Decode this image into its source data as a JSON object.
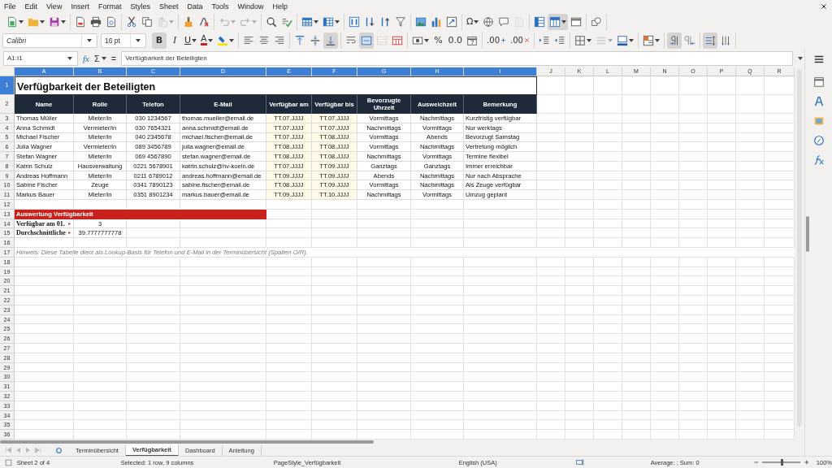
{
  "menu": [
    "File",
    "Edit",
    "View",
    "Insert",
    "Format",
    "Styles",
    "Sheet",
    "Data",
    "Tools",
    "Window",
    "Help"
  ],
  "toolbar_1": [
    [
      {
        "kind": "newsheet",
        "dropdown": true,
        "pressed": false,
        "disabled": false
      },
      {
        "kind": "folder",
        "dropdown": true,
        "pressed": false,
        "disabled": false
      },
      {
        "kind": "floppy",
        "dropdown": true,
        "pressed": false,
        "disabled": false
      }
    ],
    [
      {
        "kind": "pdf",
        "dropdown": false,
        "pressed": false,
        "disabled": false
      },
      {
        "kind": "printer",
        "dropdown": false,
        "pressed": false,
        "disabled": false
      },
      {
        "kind": "preview",
        "dropdown": false,
        "pressed": false,
        "disabled": false
      }
    ],
    [
      {
        "kind": "scissors",
        "dropdown": false,
        "pressed": false,
        "disabled": false
      },
      {
        "kind": "copy",
        "dropdown": false,
        "pressed": false,
        "disabled": false
      },
      {
        "kind": "paste",
        "dropdown": true,
        "pressed": false,
        "disabled": true
      }
    ],
    [
      {
        "kind": "brush",
        "dropdown": false,
        "pressed": false,
        "disabled": false
      },
      {
        "kind": "eraser",
        "dropdown": false,
        "pressed": false,
        "disabled": false
      }
    ],
    [
      {
        "kind": "undo",
        "dropdown": true,
        "pressed": false,
        "disabled": true
      },
      {
        "kind": "redo",
        "dropdown": true,
        "pressed": false,
        "disabled": true
      }
    ],
    [
      {
        "kind": "find",
        "dropdown": false,
        "pressed": false,
        "disabled": false
      },
      {
        "kind": "spell",
        "dropdown": false,
        "pressed": false,
        "disabled": false
      }
    ],
    [
      {
        "kind": "rows",
        "dropdown": true,
        "pressed": false,
        "disabled": false
      },
      {
        "kind": "cols",
        "dropdown": true,
        "pressed": false,
        "disabled": false
      }
    ],
    [
      {
        "kind": "sortaz",
        "dropdown": false,
        "pressed": false,
        "disabled": false
      },
      {
        "kind": "sortup",
        "dropdown": false,
        "pressed": false,
        "disabled": false
      },
      {
        "kind": "sortdown",
        "dropdown": false,
        "pressed": false,
        "disabled": false
      },
      {
        "kind": "funnel",
        "dropdown": false,
        "pressed": false,
        "disabled": false
      }
    ],
    [
      {
        "kind": "image",
        "dropdown": false,
        "pressed": false,
        "disabled": false
      },
      {
        "kind": "chart",
        "dropdown": false,
        "pressed": false,
        "disabled": false
      },
      {
        "kind": "pivot",
        "dropdown": false,
        "pressed": false,
        "disabled": false
      }
    ],
    [
      {
        "kind": "text",
        "label": "Ω",
        "dropdown": true,
        "pressed": false,
        "disabled": false
      },
      {
        "kind": "globe",
        "dropdown": false,
        "pressed": false,
        "disabled": false
      },
      {
        "kind": "comment",
        "dropdown": false,
        "pressed": false,
        "disabled": false
      },
      {
        "kind": "page",
        "dropdown": false,
        "pressed": false,
        "disabled": true
      }
    ],
    [
      {
        "kind": "freeze",
        "dropdown": false,
        "pressed": false,
        "disabled": false
      },
      {
        "kind": "freezerows",
        "dropdown": true,
        "pressed": true,
        "disabled": false
      },
      {
        "kind": "split",
        "dropdown": false,
        "pressed": false,
        "disabled": false
      }
    ],
    [
      {
        "kind": "shapes",
        "dropdown": false,
        "pressed": false,
        "disabled": false
      }
    ]
  ],
  "toolbar_2": {
    "font_name": "Calibri",
    "font_size": "16 pt",
    "groups": [
      [
        {
          "kind": "bold",
          "label": "B",
          "dropdown": false,
          "pressed": true,
          "disabled": false
        },
        {
          "kind": "italic",
          "label": "I",
          "dropdown": false,
          "pressed": false,
          "disabled": false
        },
        {
          "kind": "underline",
          "label": "U",
          "dropdown": true,
          "pressed": false,
          "disabled": false
        },
        {
          "kind": "fontcolor",
          "label": "A",
          "dropdown": true,
          "pressed": false,
          "disabled": false
        },
        {
          "kind": "highlight",
          "dropdown": true,
          "pressed": false,
          "disabled": false
        }
      ],
      [
        {
          "kind": "alignleft",
          "dropdown": false,
          "pressed": false,
          "disabled": false
        },
        {
          "kind": "aligncenter",
          "dropdown": false,
          "pressed": false,
          "disabled": false
        },
        {
          "kind": "alignright",
          "dropdown": false,
          "pressed": false,
          "disabled": false
        }
      ],
      [
        {
          "kind": "aligntop",
          "dropdown": false,
          "pressed": false,
          "disabled": false
        },
        {
          "kind": "alignmiddle",
          "dropdown": false,
          "pressed": false,
          "disabled": false
        },
        {
          "kind": "alignbottom",
          "dropdown": false,
          "pressed": true,
          "disabled": false
        }
      ],
      [
        {
          "kind": "wrap",
          "dropdown": false,
          "pressed": false,
          "disabled": false
        },
        {
          "kind": "mergecenter",
          "dropdown": false,
          "pressed": true,
          "disabled": false
        },
        {
          "kind": "merge",
          "dropdown": false,
          "pressed": false,
          "disabled": true
        },
        {
          "kind": "unmerge",
          "dropdown": false,
          "pressed": false,
          "disabled": false
        }
      ],
      [
        {
          "kind": "currency",
          "dropdown": true,
          "pressed": false,
          "disabled": false
        },
        {
          "kind": "text",
          "label": "%",
          "dropdown": false,
          "pressed": false,
          "disabled": false
        },
        {
          "kind": "text",
          "label": "0.0",
          "dropdown": false,
          "pressed": false,
          "disabled": false
        },
        {
          "kind": "calendar",
          "dropdown": false,
          "pressed": false,
          "disabled": false
        }
      ],
      [
        {
          "kind": "decadd",
          "label": ".00",
          "dropdown": false,
          "pressed": false,
          "disabled": false
        },
        {
          "kind": "decdel",
          "label": ".00",
          "dropdown": false,
          "pressed": false,
          "disabled": false
        }
      ],
      [
        {
          "kind": "indent",
          "dropdown": false,
          "pressed": false,
          "disabled": false
        },
        {
          "kind": "outdent",
          "dropdown": false,
          "pressed": false,
          "disabled": false
        }
      ],
      [
        {
          "kind": "borders",
          "dropdown": true,
          "pressed": false,
          "disabled": false
        },
        {
          "kind": "borderstyle",
          "dropdown": true,
          "pressed": false,
          "disabled": true
        },
        {
          "kind": "bordercolor",
          "dropdown": true,
          "pressed": false,
          "disabled": false
        }
      ],
      [
        {
          "kind": "conditional",
          "dropdown": true,
          "pressed": false,
          "disabled": false
        }
      ],
      [
        {
          "kind": "ltr",
          "dropdown": false,
          "pressed": true,
          "disabled": false
        },
        {
          "kind": "rtl",
          "dropdown": false,
          "pressed": false,
          "disabled": false
        }
      ],
      [
        {
          "kind": "textheight",
          "dropdown": false,
          "pressed": true,
          "disabled": false
        },
        {
          "kind": "vertical",
          "dropdown": false,
          "pressed": false,
          "disabled": false
        }
      ]
    ]
  },
  "formula_bar": {
    "name_box": "A1:I1",
    "function_wizard": "fx",
    "sum": "Σ",
    "equals": "=",
    "content": "Verfügbarkeit der Beteiligten"
  },
  "sheet": {
    "columns": [
      {
        "label": "A",
        "selected": true
      },
      {
        "label": "B",
        "selected": true
      },
      {
        "label": "C",
        "selected": true
      },
      {
        "label": "D",
        "selected": true
      },
      {
        "label": "E",
        "selected": true
      },
      {
        "label": "F",
        "selected": true
      },
      {
        "label": "G",
        "selected": true
      },
      {
        "label": "H",
        "selected": true
      },
      {
        "label": "I",
        "selected": true
      },
      {
        "label": "J",
        "selected": false
      },
      {
        "label": "K",
        "selected": false
      },
      {
        "label": "L",
        "selected": false
      },
      {
        "label": "M",
        "selected": false
      },
      {
        "label": "N",
        "selected": false
      },
      {
        "label": "O",
        "selected": false
      },
      {
        "label": "P",
        "selected": false
      },
      {
        "label": "Q",
        "selected": false
      },
      {
        "label": "R",
        "selected": false
      }
    ],
    "rows": [
      {
        "number": "1",
        "selected": true,
        "kind": "title",
        "cells": [
          "Verfügbarkeit der Beteiligten"
        ]
      },
      {
        "number": "2",
        "selected": false,
        "kind": "header",
        "cells": [
          "Name",
          "Rolle",
          "Telefon",
          "E-Mail",
          "Verfügbar am",
          "Verfügbar bis",
          "Bevorzugte Uhrzeit",
          "Ausweichzeit",
          "Bemerkung"
        ]
      },
      {
        "number": "3",
        "selected": false,
        "kind": "data",
        "cells": [
          "Thomas Müller",
          "Mieter/in",
          "030 1234567",
          "thomas.mueller@email.de",
          "TT.07.JJJJ",
          "TT.07.JJJJ",
          "Vormittags",
          "Nachmittags",
          "Kurzfristig verfügbar"
        ]
      },
      {
        "number": "4",
        "selected": false,
        "kind": "data",
        "cells": [
          "Anna Schmidt",
          "Vermieter/in",
          "030 7654321",
          "anna.schmidt@email.de",
          "TT.07.JJJJ",
          "TT.07.JJJJ",
          "Nachmittags",
          "Vormittags",
          "Nur werktags"
        ]
      },
      {
        "number": "5",
        "selected": false,
        "kind": "data",
        "cells": [
          "Michael Fischer",
          "Mieter/in",
          "040 2345678",
          "michael.fischer@email.de",
          "TT.07.JJJJ",
          "TT.08.JJJJ",
          "Vormittags",
          "Abends",
          "Bevorzugt Samstag"
        ]
      },
      {
        "number": "6",
        "selected": false,
        "kind": "data",
        "cells": [
          "Julia Wagner",
          "Vermieter/in",
          "089 3456789",
          "julia.wagner@email.de",
          "TT.08.JJJJ",
          "TT.08.JJJJ",
          "Vormittags",
          "Nachmittags",
          "Vertretung möglich"
        ]
      },
      {
        "number": "7",
        "selected": false,
        "kind": "data",
        "cells": [
          "Stefan Wagner",
          "Mieter/in",
          "069 4567890",
          "stefan.wagner@email.de",
          "TT.08.JJJJ",
          "TT.08.JJJJ",
          "Nachmittags",
          "Vormittags",
          "Termine flexibel"
        ]
      },
      {
        "number": "8",
        "selected": false,
        "kind": "data",
        "cells": [
          "Katrin Schulz",
          "Hausverwaltung",
          "0221 5678901",
          "katrin.schulz@hv-koeln.de",
          "TT.07.JJJJ",
          "TT.09.JJJJ",
          "Ganztags",
          "Ganztags",
          "Immer erreichbar"
        ]
      },
      {
        "number": "9",
        "selected": false,
        "kind": "data",
        "cells": [
          "Andreas Hoffmann",
          "Mieter/in",
          "0211 6789012",
          "andreas.hoffmann@email.de",
          "TT.09.JJJJ",
          "TT.09.JJJJ",
          "Abends",
          "Nachmittags",
          "Nur nach Absprache"
        ]
      },
      {
        "number": "10",
        "selected": false,
        "kind": "data",
        "cells": [
          "Sabine Fischer",
          "Zeuge",
          "0341 7890123",
          "sabine.fischer@email.de",
          "TT.08.JJJJ",
          "TT.09.JJJJ",
          "Vormittags",
          "Nachmittags",
          "Als Zeuge verfügbar"
        ]
      },
      {
        "number": "11",
        "selected": false,
        "kind": "data",
        "cells": [
          "Markus Bauer",
          "Mieter/in",
          "0351 8901234",
          "markus.bauer@email.de",
          "TT.09.JJJJ",
          "TT.10.JJJJ",
          "Nachmittags",
          "Vormittags",
          "Umzug geplant"
        ]
      },
      {
        "number": "12",
        "selected": false,
        "kind": "empty"
      },
      {
        "number": "13",
        "selected": false,
        "kind": "section",
        "cells": [
          "Auswertung Verfügbarkeit"
        ]
      },
      {
        "number": "14",
        "selected": false,
        "kind": "summary",
        "cells": [
          "Verfügbar am 01.",
          "3"
        ]
      },
      {
        "number": "15",
        "selected": false,
        "kind": "summary",
        "cells": [
          "Durchschnittliche",
          "39.7777777778"
        ]
      },
      {
        "number": "16",
        "selected": false,
        "kind": "empty"
      },
      {
        "number": "17",
        "selected": false,
        "kind": "note",
        "cells": [
          "Hinweis: Diese Tabelle dient als Lookup-Basis für Telefon und E-Mail in der Terminübersicht (Spalten O/R)."
        ]
      },
      {
        "number": "18",
        "selected": false,
        "kind": "empty"
      },
      {
        "number": "19",
        "selected": false,
        "kind": "empty"
      },
      {
        "number": "20",
        "selected": false,
        "kind": "empty"
      },
      {
        "number": "21",
        "selected": false,
        "kind": "empty"
      },
      {
        "number": "22",
        "selected": false,
        "kind": "empty"
      },
      {
        "number": "23",
        "selected": false,
        "kind": "empty"
      },
      {
        "number": "24",
        "selected": false,
        "kind": "empty"
      },
      {
        "number": "25",
        "selected": false,
        "kind": "empty"
      },
      {
        "number": "26",
        "selected": false,
        "kind": "empty"
      },
      {
        "number": "27",
        "selected": false,
        "kind": "empty"
      },
      {
        "number": "28",
        "selected": false,
        "kind": "empty"
      },
      {
        "number": "29",
        "selected": false,
        "kind": "empty"
      },
      {
        "number": "30",
        "selected": false,
        "kind": "empty"
      },
      {
        "number": "31",
        "selected": false,
        "kind": "empty"
      },
      {
        "number": "32",
        "selected": false,
        "kind": "empty"
      },
      {
        "number": "33",
        "selected": false,
        "kind": "empty"
      },
      {
        "number": "34",
        "selected": false,
        "kind": "empty"
      },
      {
        "number": "35",
        "selected": false,
        "kind": "empty"
      },
      {
        "number": "36",
        "selected": false,
        "kind": "empty"
      }
    ]
  },
  "sheet_tabs": [
    {
      "label": "Terminübersicht",
      "selected": false
    },
    {
      "label": "Verfügbarkeit",
      "selected": true
    },
    {
      "label": "Dashboard",
      "selected": false
    },
    {
      "label": "Anleitung",
      "selected": false
    }
  ],
  "status_bar": {
    "sheet_position": "Sheet 2 of 4",
    "selection": "Selected: 1 row, 9 columns",
    "page_style": "PageStyle_Verfügbarkeit",
    "language": "English (USA)",
    "sum": "Average: ; Sum: 0",
    "zoom": {
      "level": 0.5,
      "reading": "100%"
    }
  }
}
